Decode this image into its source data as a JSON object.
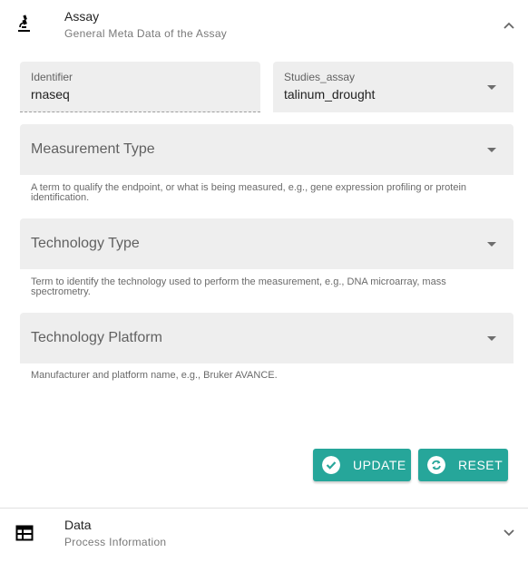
{
  "assay_panel": {
    "icon": "microscope-icon",
    "title": "Assay",
    "subtitle": "General Meta Data of the Assay",
    "chevron": "chevron-up-icon"
  },
  "form": {
    "identifier": {
      "label": "Identifier",
      "value": "rnaseq"
    },
    "studies_assay": {
      "label": "Studies_assay",
      "value": "talinum_drought"
    },
    "measurement_type": {
      "placeholder": "Measurement Type",
      "hint": "A term to qualify the endpoint, or what is being measured, e.g., gene expression profiling or protein identification."
    },
    "technology_type": {
      "placeholder": "Technology Type",
      "hint": "Term to identify the technology used to perform the measurement, e.g., DNA microarray, mass spectrometry."
    },
    "technology_platform": {
      "placeholder": "Technology Platform",
      "hint": "Manufacturer and platform name, e.g., Bruker AVANCE."
    }
  },
  "actions": {
    "update_label": "UPDATE",
    "update_icon": "check-circle-icon",
    "reset_label": "RESET",
    "reset_icon": "refresh-icon",
    "button_color": "#26a69a"
  },
  "data_panel": {
    "icon": "table-icon",
    "title": "Data",
    "subtitle": "Process Information",
    "chevron": "chevron-down-icon"
  }
}
